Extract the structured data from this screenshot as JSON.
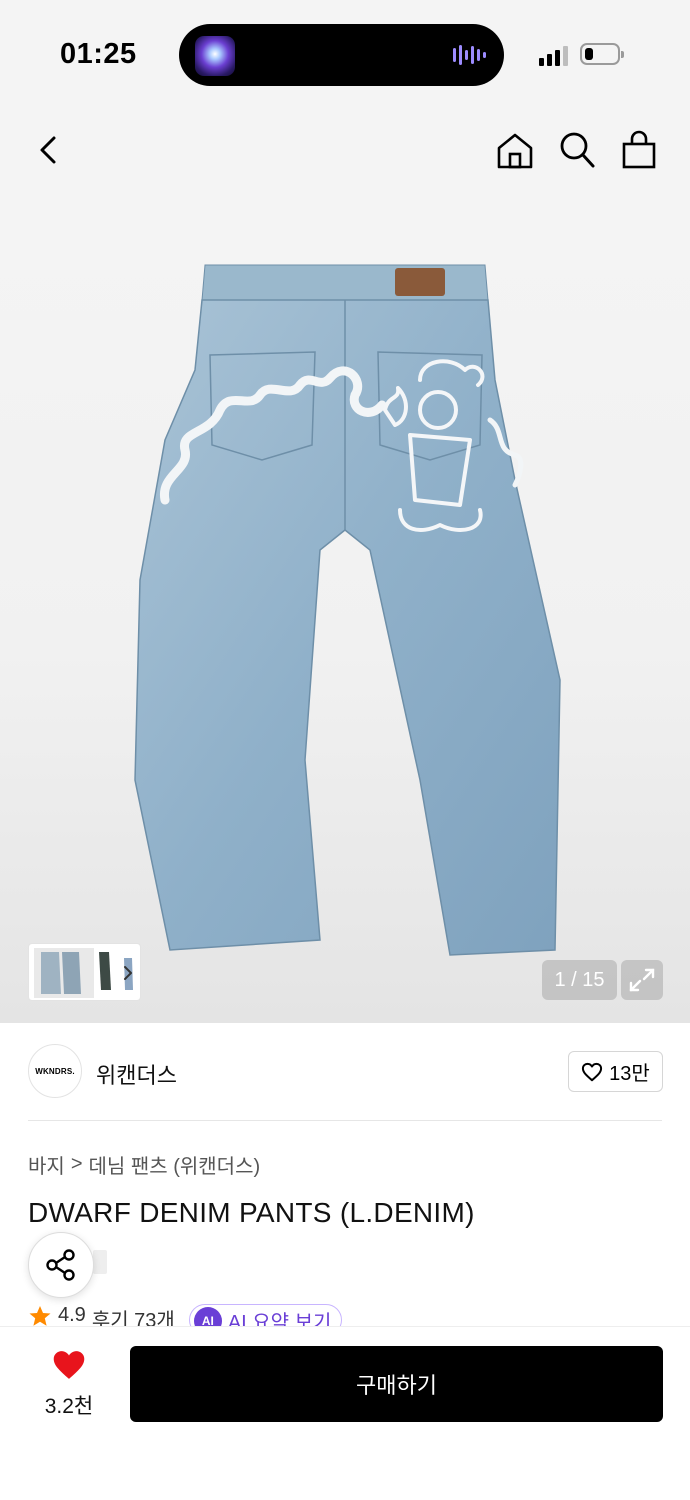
{
  "status_bar": {
    "time": "01:25",
    "icons": [
      "now-playing-art",
      "audio-wave-icon",
      "cellular-signal-icon",
      "battery-icon"
    ]
  },
  "nav": {
    "icons": [
      "back-arrow-icon",
      "home-icon",
      "search-icon",
      "shopping-bag-icon"
    ]
  },
  "gallery": {
    "pager": "1 / 15",
    "current_index": 1,
    "total": 15
  },
  "brand": {
    "logo_text": "WKNDRS.",
    "name": "위캔더스",
    "like_count": "13만"
  },
  "breadcrumb": {
    "category": "바지",
    "separator": ">",
    "subcategory": "데님 팬츠 (위캔더스)"
  },
  "product": {
    "title": "DWARF DENIM PANTS (L.DENIM)"
  },
  "rating": {
    "score": "4.9",
    "reviews": "후기 73개",
    "ai_badge": "AI",
    "ai_summary_label": "AI 요약 보기"
  },
  "bottom_bar": {
    "wish_count": "3.2천",
    "buy_label": "구매하기"
  },
  "colors": {
    "accent_red": "#e8141c",
    "ai_purple": "#6a3fd6",
    "star": "#ff8a00"
  }
}
